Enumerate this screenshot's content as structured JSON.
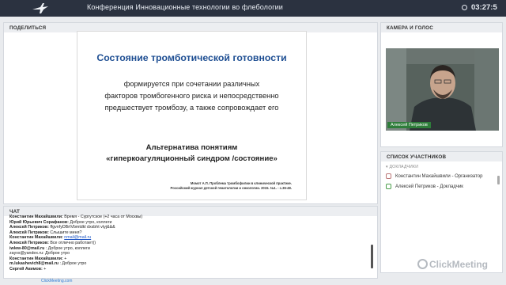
{
  "header": {
    "title": "Конференция Инновационные технологии во флебологии",
    "clock": "03:27:5"
  },
  "share_panel": {
    "label": "ПОДЕЛИТЬСЯ",
    "slide": {
      "title": "Состояние тромботической готовности",
      "body": [
        "формируется при сочетании различных",
        "факторов тромбогенного риска и непосредственно",
        "предшествует тромбозу,  а также сопровождает его"
      ],
      "subtitle": [
        "Альтернатива понятиям",
        "«гиперкоагуляционный синдром /состояние»"
      ],
      "reference": [
        "Момот А.П. Проблема тромбофилии в клинической практике.",
        "Российский журнал детской гематологии и онкологии. 2015. №1. - с.36-48."
      ]
    }
  },
  "camera_panel": {
    "label": "КАМЕРА И ГОЛОС",
    "speaker_name": "Алексей Петриков"
  },
  "participants_panel": {
    "label": "СПИСОК УЧАСТНИКОВ",
    "group": "ДОКЛАДЧИКИ",
    "items": [
      {
        "name": "Константин Махайшвили - Организатор"
      },
      {
        "name": "Алексей Петриков  - Докладчик"
      }
    ]
  },
  "chat_panel": {
    "label": "ЧАТ",
    "messages": [
      {
        "user": "Константин Махайшвили:",
        "text": " Время - Сургутское (+2 часа от Москвы)"
      },
      {
        "user": "Юрий Юрьевич Сорафанов:",
        "text": " Доброе утро, коллеги"
      },
      {
        "user": "Алексей Петриков:",
        "text": " ffgvnfyDBrtVbmtdkl dxsbht vtyj&&&"
      },
      {
        "user": "Алексей Петриков:",
        "text": " Слышите меня?"
      },
      {
        "user": "Константин Махайшвили:",
        "text": " ",
        "link": "nmail@mail.ru"
      },
      {
        "user": "Алексей Петриков:",
        "text": " Все отлично работает))"
      },
      {
        "user": "iwlew-80@mail.ru",
        "text": " : Доброе утро, коллеги"
      },
      {
        "user": "",
        "text": "zayvs@yandex.ru: Доброе утро"
      },
      {
        "user": "Константин Махайшвили:",
        "text": " +"
      },
      {
        "user": "m.lukashevich8@mail.ru",
        "text": " : Доброе утро"
      },
      {
        "user": "Сергей Акимов:",
        "text": " +"
      }
    ]
  },
  "footer": {
    "link": "ClickMeeting.com",
    "brand": "ClickMeeting"
  },
  "colors": {
    "header_bg": "#2b3240",
    "slide_title": "#1f4f93",
    "name_tag": "#2e7d3a",
    "link": "#1d55c4"
  }
}
